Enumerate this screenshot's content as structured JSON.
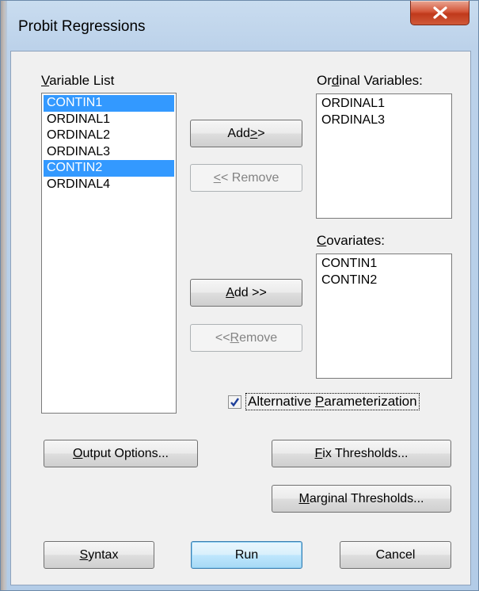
{
  "window": {
    "title": "Probit Regressions"
  },
  "variable_list": {
    "label_pre": "",
    "label_ul": "V",
    "label_post": "ariable List",
    "items": [
      {
        "name": "CONTIN1",
        "selected": true
      },
      {
        "name": "ORDINAL1",
        "selected": false
      },
      {
        "name": "ORDINAL2",
        "selected": false
      },
      {
        "name": "ORDINAL3",
        "selected": false
      },
      {
        "name": "CONTIN2",
        "selected": true
      },
      {
        "name": "ORDINAL4",
        "selected": false
      }
    ]
  },
  "ordinal_variables": {
    "label_pre": "Or",
    "label_ul": "d",
    "label_post": "inal Variables:",
    "items": [
      "ORDINAL1",
      "ORDINAL3"
    ]
  },
  "covariates": {
    "label_pre": "",
    "label_ul": "C",
    "label_post": "ovariates:",
    "items": [
      "CONTIN1",
      "CONTIN2"
    ]
  },
  "buttons": {
    "add_ordinal": {
      "pre": "Add ",
      "ul": ">",
      "post": ">"
    },
    "remove_ordinal": {
      "pre": "",
      "ul": "<",
      "post": "< Remove"
    },
    "add_covariate": {
      "pre": "",
      "ul": "A",
      "post": "dd >>"
    },
    "remove_covariate": {
      "pre": "<< ",
      "ul": "R",
      "post": "emove"
    },
    "output_options": {
      "pre": "",
      "ul": "O",
      "post": "utput Options..."
    },
    "fix_thresholds": {
      "pre": "",
      "ul": "F",
      "post": "ix Thresholds..."
    },
    "marginal_thresholds": {
      "pre": "",
      "ul": "M",
      "post": "arginal Thresholds..."
    },
    "syntax": {
      "pre": "",
      "ul": "S",
      "post": "yntax"
    },
    "run": {
      "pre": "Run",
      "ul": "",
      "post": ""
    },
    "cancel": {
      "pre": "Cancel",
      "ul": "",
      "post": ""
    }
  },
  "alt_param": {
    "checked": true,
    "pre": "Alternative ",
    "ul": "P",
    "post": "arameterization"
  },
  "colors": {
    "selection": "#3399ff",
    "close_button": "#c0391b"
  }
}
